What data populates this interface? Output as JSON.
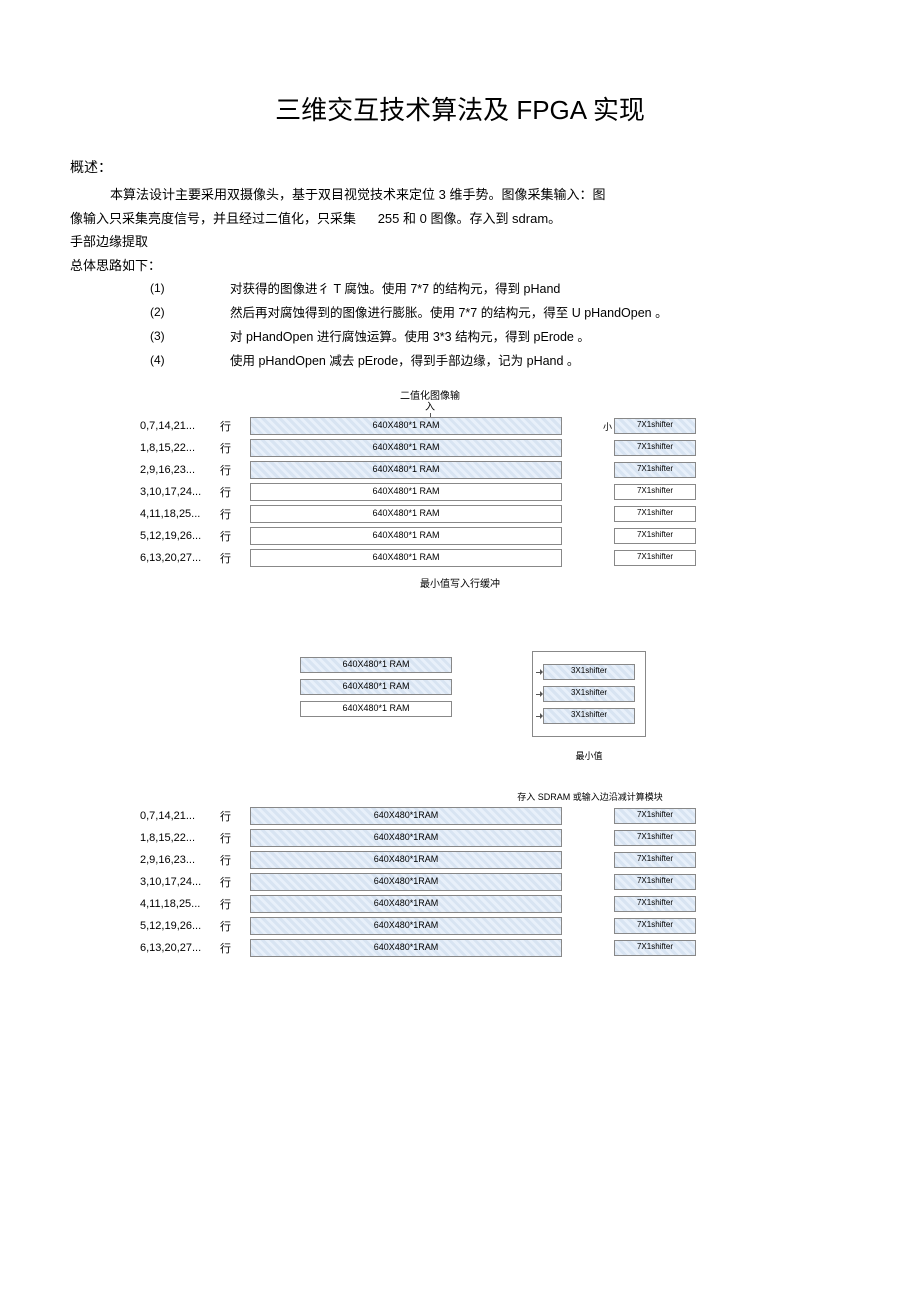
{
  "title": "三维交互技术算法及 FPGA 实现",
  "overview_head": "概述：",
  "para1a": "本算法设计主要采用双摄像头，基于双目视觉技术来定位 3 维手势。图像采集输入：图",
  "para1b": "像输入只采集亮度信号，并且经过二值化，只采集",
  "para1c": "255 和 0 图像。存入到 sdram。",
  "hand_edge_head": "手部边缘提取",
  "overall_head": "总体思路如下：",
  "steps": [
    {
      "n": "(1)",
      "t": "对获得的图像进彳 T 腐蚀。使用  7*7 的结构元，得到 pHand"
    },
    {
      "n": "(2)",
      "t": "然后再对腐蚀得到的图像进行膨胀。使用        7*7 的结构元，得至 U pHandOpen 。"
    },
    {
      "n": "(3)",
      "t": "对 pHandOpen 进行腐蚀运算。使用 3*3 结构元，得到 pErode 。"
    },
    {
      "n": "(4)",
      "t": "使用  pHandOpen 减去 pErode，得到手部边缘，记为 pHand 。"
    }
  ],
  "dia_top_label": "二值化图像输入",
  "row_word": "行",
  "small_word": "小",
  "rows1": [
    {
      "idx": "0,7,14,21...",
      "ram": "640X480*1 RAM",
      "sh": "7X1shifter",
      "shade": true
    },
    {
      "idx": "1,8,15,22...",
      "ram": "640X480*1 RAM",
      "sh": "7X1shifter",
      "shade": true
    },
    {
      "idx": "2,9,16,23...",
      "ram": "640X480*1 RAM",
      "sh": "7X1shifter",
      "shade": true
    },
    {
      "idx": "3,10,17,24...",
      "ram": "640X480*1 RAM",
      "sh": "7X1shifter",
      "shade": false
    },
    {
      "idx": "4,11,18,25...",
      "ram": "640X480*1 RAM",
      "sh": "7X1shifter",
      "shade": false
    },
    {
      "idx": "5,12,19,26...",
      "ram": "640X480*1 RAM",
      "sh": "7X1shifter",
      "shade": false
    },
    {
      "idx": "6,13,20,27...",
      "ram": "640X480*1 RAM",
      "sh": "7X1shifter",
      "shade": false
    }
  ],
  "mini_caption": "最小值写入行缓冲",
  "mid_rams": [
    {
      "t": "640X480*1 RAM",
      "shade": true
    },
    {
      "t": "640X480*1 RAM",
      "shade": true
    },
    {
      "t": "640X480*1 RAM",
      "shade": false
    }
  ],
  "mid_shifters": [
    "3X1shifter",
    "3X1shifter",
    "3X1shifter"
  ],
  "min_label": "最小值",
  "sdram_label": "存入 SDRAM 或输入边沿减计算模块",
  "rows2": [
    {
      "idx": "0,7,14,21...",
      "ram": "640X480*1RAM",
      "sh": "7X1shifter"
    },
    {
      "idx": "1,8,15,22...",
      "ram": "640X480*1RAM",
      "sh": "7X1shifter"
    },
    {
      "idx": "2,9,16,23...",
      "ram": "640X480*1RAM",
      "sh": "7X1shifter"
    },
    {
      "idx": "3,10,17,24...",
      "ram": "640X480*1RAM",
      "sh": "7X1shifter"
    },
    {
      "idx": "4,11,18,25...",
      "ram": "640X480*1RAM",
      "sh": "7X1shifter"
    },
    {
      "idx": "5,12,19,26...",
      "ram": "640X480*1RAM",
      "sh": "7X1shifter"
    },
    {
      "idx": "6,13,20,27...",
      "ram": "640X480*1RAM",
      "sh": "7X1shifter"
    }
  ]
}
